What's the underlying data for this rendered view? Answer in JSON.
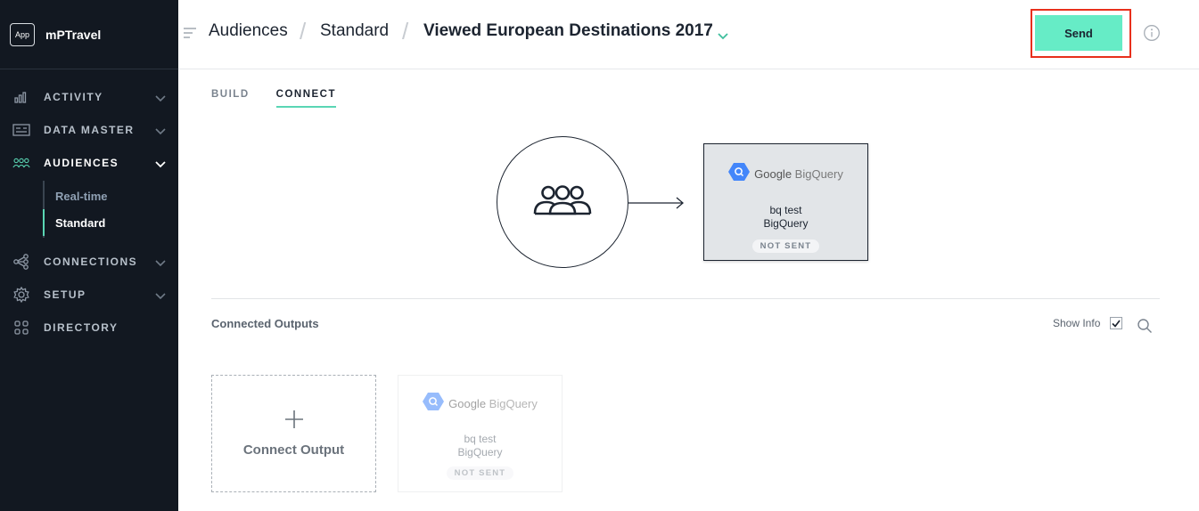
{
  "app": {
    "badge": "App",
    "name": "mPTravel"
  },
  "sidebar": {
    "items": [
      {
        "label": "ACTIVITY",
        "icon": "bar-chart-icon",
        "expandable": true
      },
      {
        "label": "DATA MASTER",
        "icon": "data-master-icon",
        "expandable": true
      },
      {
        "label": "AUDIENCES",
        "icon": "audiences-icon",
        "expandable": true,
        "active": true
      },
      {
        "label": "CONNECTIONS",
        "icon": "connections-icon",
        "expandable": true
      },
      {
        "label": "SETUP",
        "icon": "gear-icon",
        "expandable": true
      },
      {
        "label": "DIRECTORY",
        "icon": "grid-icon",
        "expandable": false
      }
    ],
    "audiences_sub": [
      {
        "label": "Real-time"
      },
      {
        "label": "Standard",
        "active": true
      }
    ]
  },
  "header": {
    "breadcrumb": [
      "Audiences",
      "Standard"
    ],
    "title": "Viewed European Destinations 2017",
    "send_label": "Send"
  },
  "tabs": [
    {
      "label": "BUILD"
    },
    {
      "label": "CONNECT",
      "active": true
    }
  ],
  "destination": {
    "logo_google": "Google",
    "logo_bigquery": "BigQuery",
    "name": "bq test",
    "type": "BigQuery",
    "status": "NOT SENT"
  },
  "outputs_section": {
    "title": "Connected Outputs",
    "show_info_label": "Show Info",
    "show_info_checked": true,
    "connect_output_label": "Connect Output",
    "cards": [
      {
        "logo_google": "Google",
        "logo_bigquery": "BigQuery",
        "name": "bq test",
        "type": "BigQuery",
        "status": "NOT SENT"
      }
    ]
  },
  "colors": {
    "accent": "#66ecc6",
    "sidebar_bg": "#121821",
    "highlight": "#e8301c"
  }
}
